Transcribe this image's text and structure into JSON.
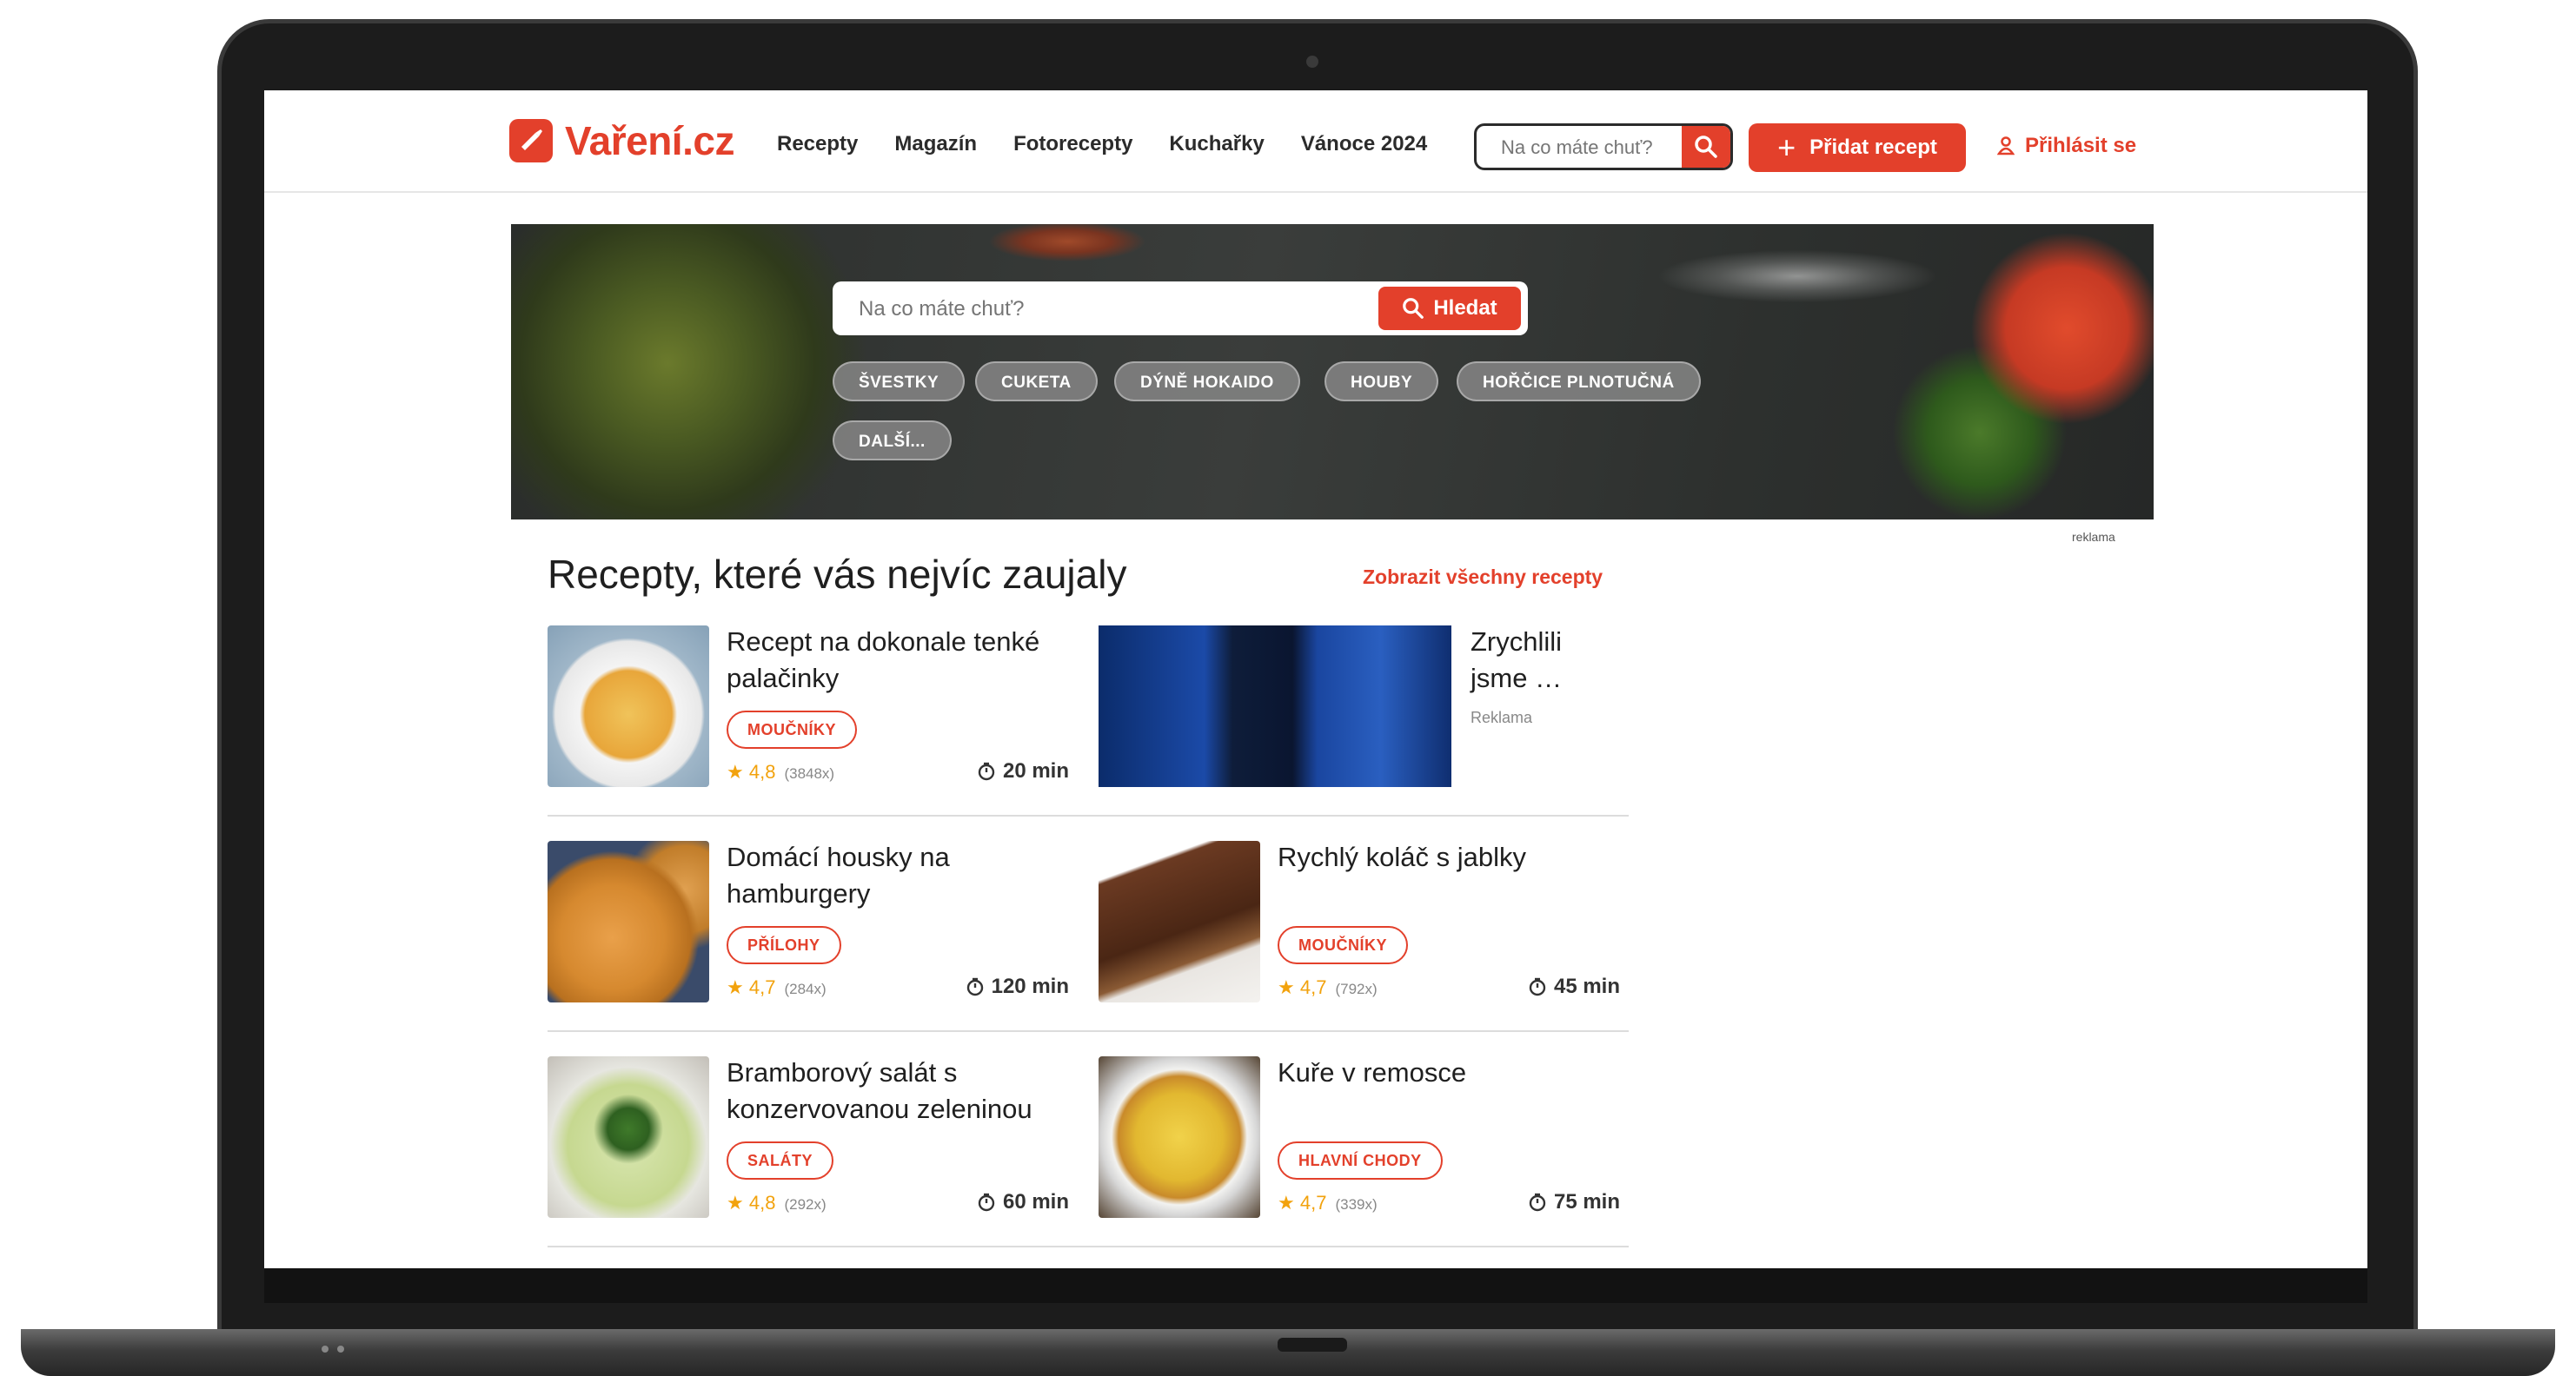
{
  "site": {
    "logo_text": "Vaření.cz",
    "nav": [
      "Recepty",
      "Magazín",
      "Fotorecepty",
      "Kuchařky",
      "Vánoce 2024"
    ],
    "header_search_placeholder": "Na co máte chuť?",
    "add_recipe_label": "Přidat recept",
    "login_label": "Přihlásit se"
  },
  "hero": {
    "search_placeholder": "Na co máte chuť?",
    "search_button": "Hledat",
    "tags": [
      "ŠVESTKY",
      "CUKETA",
      "DÝNĚ HOKAIDO",
      "HOUBY",
      "HOŘČICE PLNOTUČNÁ",
      "DALŠÍ..."
    ],
    "ad_label": "reklama"
  },
  "section": {
    "title": "Recepty, které vás nejvíc zaujaly",
    "show_all": "Zobrazit všechny recepty"
  },
  "ad_card": {
    "title": "Zrychlili jsme …",
    "label": "Reklama"
  },
  "recipes": [
    {
      "title": "Recept na dokonale tenké palačinky",
      "category": "MOUČNÍKY",
      "rating": "4,8",
      "count": "(3848x)",
      "time": "20 min"
    },
    {
      "title": "Domácí housky na hamburgery",
      "category": "PŘÍLOHY",
      "rating": "4,7",
      "count": "(284x)",
      "time": "120 min"
    },
    {
      "title": "Rychlý koláč s jablky",
      "category": "MOUČNÍKY",
      "rating": "4,7",
      "count": "(792x)",
      "time": "45 min"
    },
    {
      "title": "Bramborový salát s konzervovanou zeleninou",
      "category": "SALÁTY",
      "rating": "4,8",
      "count": "(292x)",
      "time": "60 min"
    },
    {
      "title": "Kuře v remosce",
      "category": "HLAVNÍ CHODY",
      "rating": "4,7",
      "count": "(339x)",
      "time": "75 min"
    }
  ],
  "colors": {
    "brand": "#e3402b",
    "star": "#f2a20d"
  }
}
